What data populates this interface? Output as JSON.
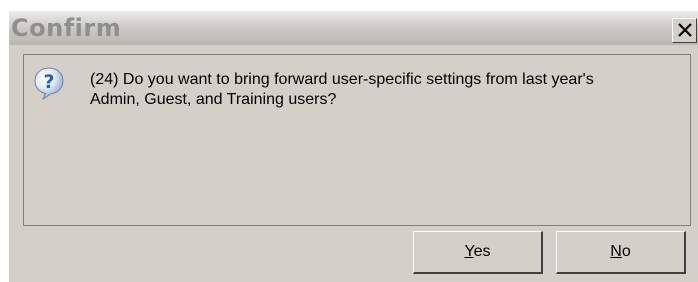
{
  "window": {
    "title": "Confirm",
    "close_glyph": "✕"
  },
  "message": {
    "icon": "question-icon",
    "text_line1": "(24) Do you want to bring forward user-specific settings from last year's",
    "text_line2": "Admin, Guest, and Training users?"
  },
  "buttons": {
    "yes_mnemonic": "Y",
    "yes_rest": "es",
    "no_mnemonic": "N",
    "no_rest": "o"
  },
  "colors": {
    "dialog_bg": "#d4d0c8",
    "title_text": "#8f8f8f",
    "icon_blue": "#1f5fbf"
  }
}
